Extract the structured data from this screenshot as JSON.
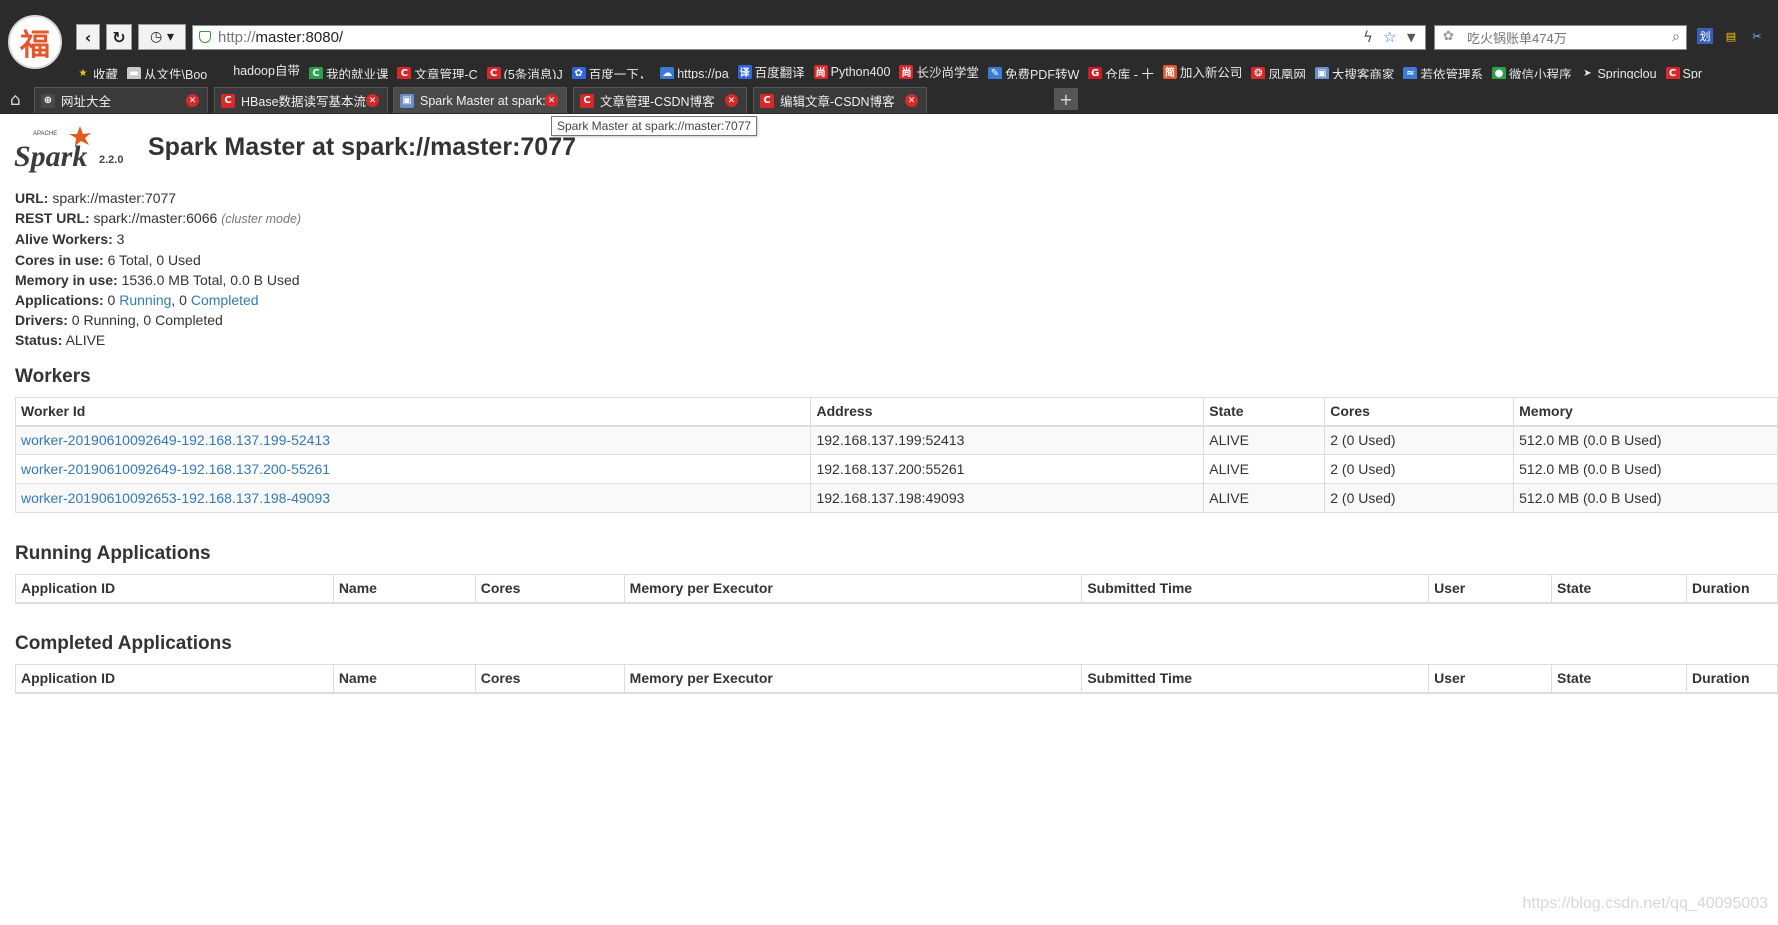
{
  "browser": {
    "url_prefix": "http://",
    "url_host": "master:8080/",
    "search_placeholder": "吃火锅账单474万",
    "bookmarks": [
      {
        "label": "收藏",
        "icon": "star-icon",
        "color": "#f5c518"
      },
      {
        "label": "从文件\\Boo",
        "icon": "folder-icon",
        "color": "#c8c8c8"
      },
      {
        "label": "hadoop自带",
        "icon": "blank-icon",
        "color": "#2b2b2b"
      },
      {
        "label": "我的就业课",
        "icon": "green-c-icon",
        "color": "#2aa14a"
      },
      {
        "label": "文章管理-C",
        "icon": "csdn-icon",
        "color": "#d7292a"
      },
      {
        "label": "(5条消息)J",
        "icon": "csdn-icon",
        "color": "#d7292a"
      },
      {
        "label": "百度一下，",
        "icon": "baidu-paw-icon",
        "color": "#3065dd"
      },
      {
        "label": "https://pa",
        "icon": "cloud-icon",
        "color": "#3a7bd5"
      },
      {
        "label": "百度翻译",
        "icon": "translate-icon",
        "color": "#3065dd"
      },
      {
        "label": "Python400",
        "icon": "shang-icon",
        "color": "#d7292a"
      },
      {
        "label": "长沙尚学堂",
        "icon": "shang-icon",
        "color": "#d7292a"
      },
      {
        "label": "免费PDF转W",
        "icon": "feather-icon",
        "color": "#3a7bd5"
      },
      {
        "label": "仓库 - 十",
        "icon": "gitee-icon",
        "color": "#c71d23"
      },
      {
        "label": "加入新公司",
        "icon": "jian-icon",
        "color": "#e4572e"
      },
      {
        "label": "凤凰网",
        "icon": "phoenix-icon",
        "color": "#d7292a"
      },
      {
        "label": "大搜客商家",
        "icon": "frame-icon",
        "color": "#6a8fc8"
      },
      {
        "label": "若依管理系",
        "icon": "ruoyi-icon",
        "color": "#3a7bd5"
      },
      {
        "label": "微信小程序",
        "icon": "wechat-icon",
        "color": "#2aa14a"
      },
      {
        "label": "Springclou",
        "icon": "cursor-icon",
        "color": "#e8e8e8"
      },
      {
        "label": "Spr",
        "icon": "csdn-icon",
        "color": "#d7292a"
      }
    ],
    "tabs": [
      {
        "label": "网址大全",
        "icon": "globe-icon",
        "color": "#4a4a4a",
        "active": false
      },
      {
        "label": "HBase数据读写基本流程",
        "icon": "csdn-icon",
        "color": "#d7292a",
        "active": false
      },
      {
        "label": "Spark Master at spark://",
        "icon": "frame-icon",
        "color": "#6a8fc8",
        "active": true
      },
      {
        "label": "文章管理-CSDN博客",
        "icon": "csdn-icon",
        "color": "#d7292a",
        "active": false
      },
      {
        "label": "编辑文章-CSDN博客",
        "icon": "csdn-icon",
        "color": "#d7292a",
        "active": false
      }
    ],
    "tooltip": "Spark Master at spark://master:7077"
  },
  "page": {
    "logo_text": "Spark",
    "logo_super": "APACHE",
    "version": "2.2.0",
    "title": "Spark Master at spark://master:7077",
    "info": {
      "url_label": "URL:",
      "url_value": " spark://master:7077",
      "rest_label": "REST URL:",
      "rest_value": " spark://master:6066 ",
      "rest_note": "(cluster mode)",
      "alive_label": "Alive Workers:",
      "alive_value": " 3",
      "cores_label": "Cores in use:",
      "cores_value": " 6 Total, 0 Used",
      "memory_label": "Memory in use:",
      "memory_value": " 1536.0 MB Total, 0.0 B Used",
      "apps_label": "Applications:",
      "apps_running_count": " 0 ",
      "apps_running_link": "Running",
      "apps_sep": ", 0 ",
      "apps_completed_link": "Completed",
      "drivers_label": "Drivers:",
      "drivers_value": " 0 Running, 0 Completed",
      "status_label": "Status:",
      "status_value": " ALIVE"
    },
    "workers": {
      "title": "Workers",
      "headers": [
        "Worker Id",
        "Address",
        "State",
        "Cores",
        "Memory"
      ],
      "rows": [
        [
          "worker-20190610092649-192.168.137.199-52413",
          "192.168.137.199:52413",
          "ALIVE",
          "2 (0 Used)",
          "512.0 MB (0.0 B Used)"
        ],
        [
          "worker-20190610092649-192.168.137.200-55261",
          "192.168.137.200:55261",
          "ALIVE",
          "2 (0 Used)",
          "512.0 MB (0.0 B Used)"
        ],
        [
          "worker-20190610092653-192.168.137.198-49093",
          "192.168.137.198:49093",
          "ALIVE",
          "2 (0 Used)",
          "512.0 MB (0.0 B Used)"
        ]
      ]
    },
    "running": {
      "title": "Running Applications",
      "headers": [
        "Application ID",
        "Name",
        "Cores",
        "Memory per Executor",
        "Submitted Time",
        "User",
        "State",
        "Duration"
      ]
    },
    "completed": {
      "title": "Completed Applications",
      "headers": [
        "Application ID",
        "Name",
        "Cores",
        "Memory per Executor",
        "Submitted Time",
        "User",
        "State",
        "Duration"
      ]
    },
    "watermark": "https://blog.csdn.net/qq_40095003"
  }
}
